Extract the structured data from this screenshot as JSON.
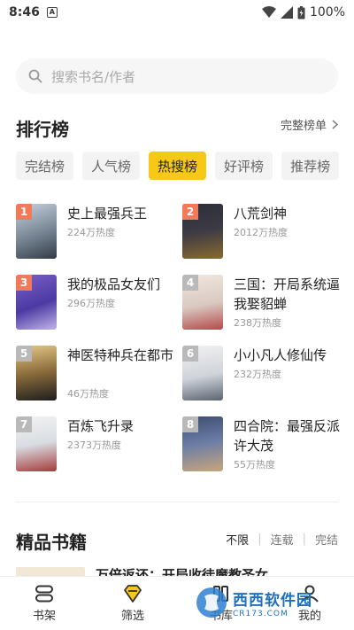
{
  "status": {
    "time": "8:46",
    "app_indicator": "A",
    "battery": "100%"
  },
  "search": {
    "placeholder": "搜索书名/作者"
  },
  "ranking": {
    "title": "排行榜",
    "more": "完整榜单",
    "tabs": [
      {
        "label": "完结榜"
      },
      {
        "label": "人气榜"
      },
      {
        "label": "热搜榜",
        "active": true
      },
      {
        "label": "好评榜"
      },
      {
        "label": "推荐榜"
      }
    ],
    "books": [
      {
        "rank": "1",
        "title": "史上最强兵王",
        "heat": "224万热度"
      },
      {
        "rank": "2",
        "title": "八荒剑神",
        "heat": "2012万热度"
      },
      {
        "rank": "3",
        "title": "我的极品女友们",
        "heat": "296万热度"
      },
      {
        "rank": "4",
        "title": "三国：开局系统逼我娶貂蝉",
        "heat": "238万热度"
      },
      {
        "rank": "5",
        "title": "神医特种兵在都市",
        "heat": "46万热度"
      },
      {
        "rank": "6",
        "title": "小小凡人修仙传",
        "heat": "232万热度"
      },
      {
        "rank": "7",
        "title": "百炼飞升录",
        "heat": "2373万热度"
      },
      {
        "rank": "8",
        "title": "四合院：最强反派许大茂",
        "heat": "55万热度"
      }
    ],
    "rank_colors": [
      "#f07a5a",
      "#f07a5a",
      "#f07a5a",
      "#b9b9b9",
      "#b9b9b9",
      "#b9b9b9",
      "#b9b9b9",
      "#b9b9b9"
    ]
  },
  "featured": {
    "title": "精品书籍",
    "filters": {
      "all": "不限",
      "ongoing": "连载",
      "finished": "完结"
    },
    "peek_title": "万倍返还：开局收徒魔教圣女"
  },
  "nav": {
    "shelf": "书架",
    "filter": "筛选",
    "library": "书库",
    "mine": "我的"
  },
  "watermark": {
    "brand": "西西软件园",
    "url": "CR173.COM"
  },
  "colors": {
    "accent": "#f7c815"
  }
}
